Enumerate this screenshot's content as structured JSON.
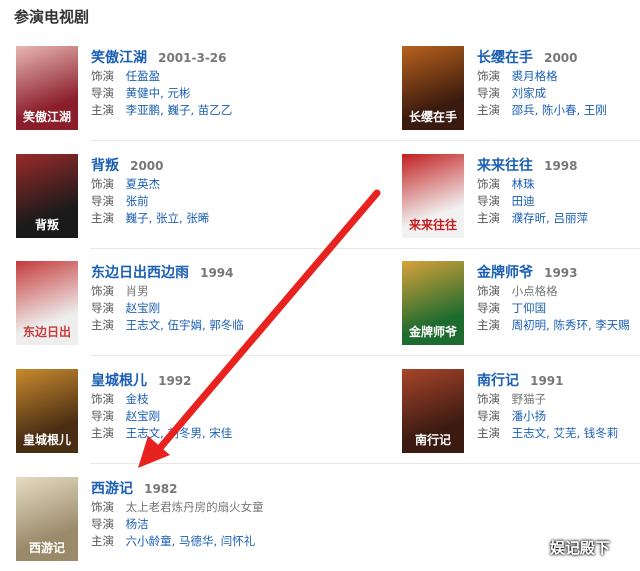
{
  "section": {
    "title": "参演电视剧"
  },
  "labels": {
    "role": "饰演",
    "director": "导演",
    "starring": "主演"
  },
  "shows": [
    {
      "title": "笑傲江湖",
      "year": "2001-3-26",
      "role": "任盈盈",
      "director": "黄健中, 元彬",
      "cast": "李亚鹏, 巍子, 苗乙乙",
      "poster_text": "笑傲江湖",
      "poster_colors": [
        "#8b1e2b",
        "#e8b7b3"
      ]
    },
    {
      "title": "长缨在手",
      "year": "2000",
      "role": "裘月格格",
      "director": "刘家成",
      "cast": "邵兵, 陈小春, 王刚",
      "poster_text": "长缨在手",
      "poster_colors": [
        "#3a1a0e",
        "#b8621d"
      ]
    },
    {
      "title": "背叛",
      "year": "2000",
      "role": "夏英杰",
      "director": "张前",
      "cast": "巍子, 张立, 张晞",
      "poster_text": "背叛",
      "poster_colors": [
        "#1a1a1a",
        "#9a2a2a"
      ]
    },
    {
      "title": "来来往往",
      "year": "1998",
      "role": "林珠",
      "director": "田迪",
      "cast": "濮存昕, 吕丽萍",
      "poster_text": "来来往往",
      "poster_colors": [
        "#f2f2f2",
        "#c21f1f"
      ]
    },
    {
      "title": "东边日出西边雨",
      "year": "1994",
      "role": "肖男",
      "director": "赵宝刚",
      "cast": "王志文, 伍宇娟, 郭冬临",
      "poster_text": "东边日出",
      "poster_colors": [
        "#eeeeee",
        "#c63b3b"
      ]
    },
    {
      "title": "金牌师爷",
      "year": "1993",
      "role": "小点格格",
      "director": "丁仰国",
      "cast": "周初明, 陈秀环, 李天赐",
      "poster_text": "金牌师爷",
      "poster_colors": [
        "#1e6b2f",
        "#d8a23a"
      ]
    },
    {
      "title": "皇城根儿",
      "year": "1992",
      "role": "金枝",
      "director": "赵宝刚",
      "cast": "王志文, 刘冬男, 宋佳",
      "poster_text": "皇城根儿",
      "poster_colors": [
        "#4a2e14",
        "#c98a2e"
      ]
    },
    {
      "title": "南行记",
      "year": "1991",
      "role": "野猫子",
      "director": "潘小扬",
      "cast": "王志文, 艾芜, 钱冬莉",
      "poster_text": "南行记",
      "poster_colors": [
        "#3b1a12",
        "#a8452a"
      ]
    },
    {
      "title": "西游记",
      "year": "1982",
      "role": "太上老君炼丹房的扇火女童",
      "director": "杨洁",
      "cast": "六小龄童, 马德华, 闫怀礼",
      "poster_text": "西游记",
      "poster_colors": [
        "#9a8a6a",
        "#e6dcc4"
      ]
    }
  ],
  "watermark": "娱记殿下",
  "colors": {
    "link": "#1a5fb4",
    "arrow": "#e8231f"
  }
}
